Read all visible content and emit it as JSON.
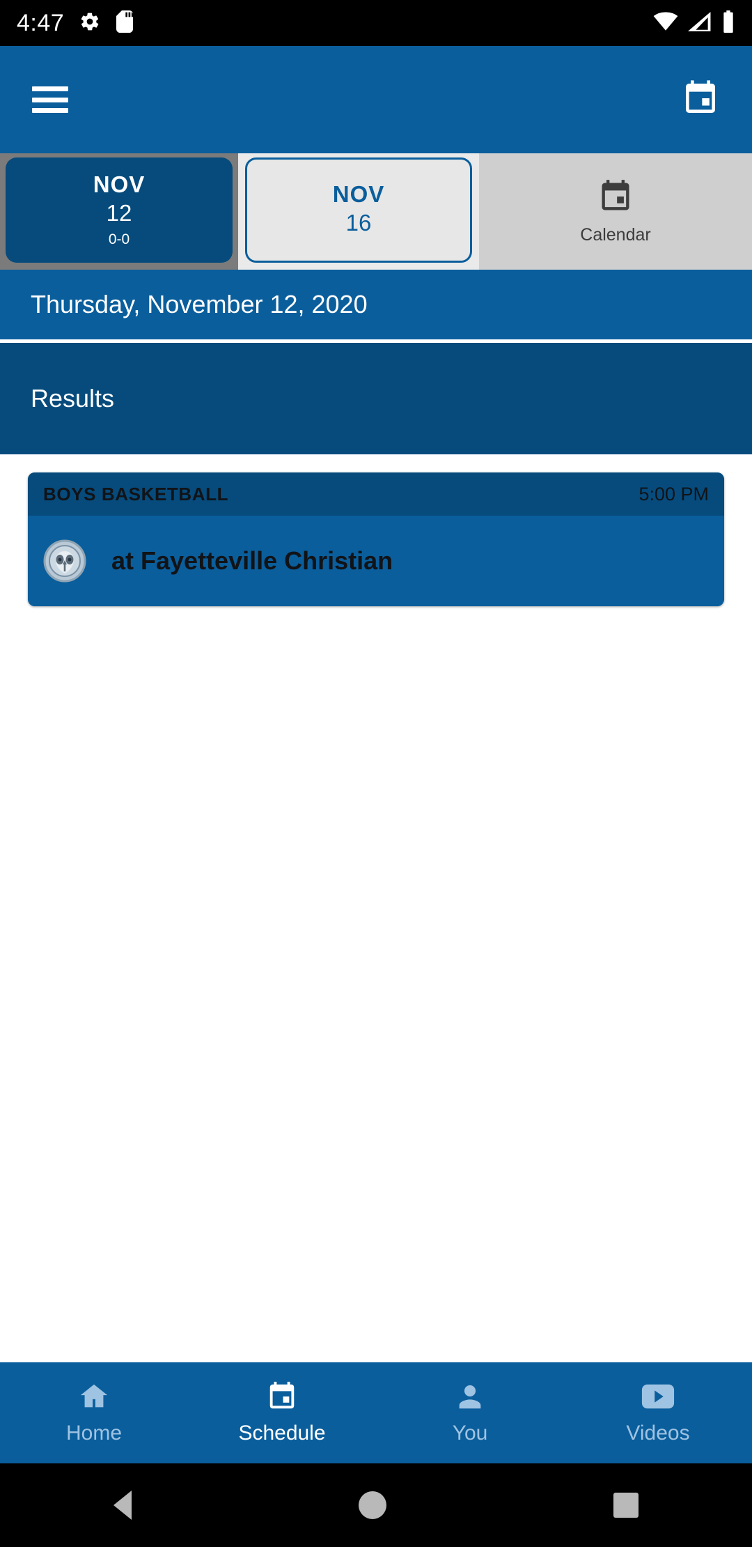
{
  "statusbar": {
    "time": "4:47",
    "icons": [
      "gear-icon",
      "sd-card-icon"
    ],
    "right_icons": [
      "wifi-icon",
      "cell-signal-icon",
      "battery-icon"
    ]
  },
  "appbar": {
    "menu_icon": "hamburger-menu-icon",
    "calendar_icon": "calendar-icon",
    "background": "#0A5E9C"
  },
  "date_tabs": [
    {
      "month": "NOV",
      "day": "12",
      "record": "0-0",
      "selected": true
    },
    {
      "month": "NOV",
      "day": "16",
      "record": "",
      "selected": false
    }
  ],
  "calendar_tab": {
    "label": "Calendar",
    "icon": "calendar-icon"
  },
  "date_header": {
    "text": "Thursday, November 12, 2020"
  },
  "section": {
    "title": "Results"
  },
  "games": [
    {
      "sport": "BOYS BASKETBALL",
      "time": "5:00 PM",
      "opponent": "at Fayetteville Christian",
      "logo": "owl-team-logo"
    }
  ],
  "bottom_nav": [
    {
      "label": "Home",
      "icon": "home-icon",
      "active": false
    },
    {
      "label": "Schedule",
      "icon": "calendar-icon",
      "active": true
    },
    {
      "label": "You",
      "icon": "person-icon",
      "active": false
    },
    {
      "label": "Videos",
      "icon": "video-play-icon",
      "active": false
    }
  ],
  "system_nav": {
    "back": "back-triangle-icon",
    "home": "home-circle-icon",
    "recents": "recents-square-icon"
  },
  "colors": {
    "primary": "#0A5E9C",
    "dark": "#064B7C",
    "accent_light": "#9FC3E2"
  }
}
